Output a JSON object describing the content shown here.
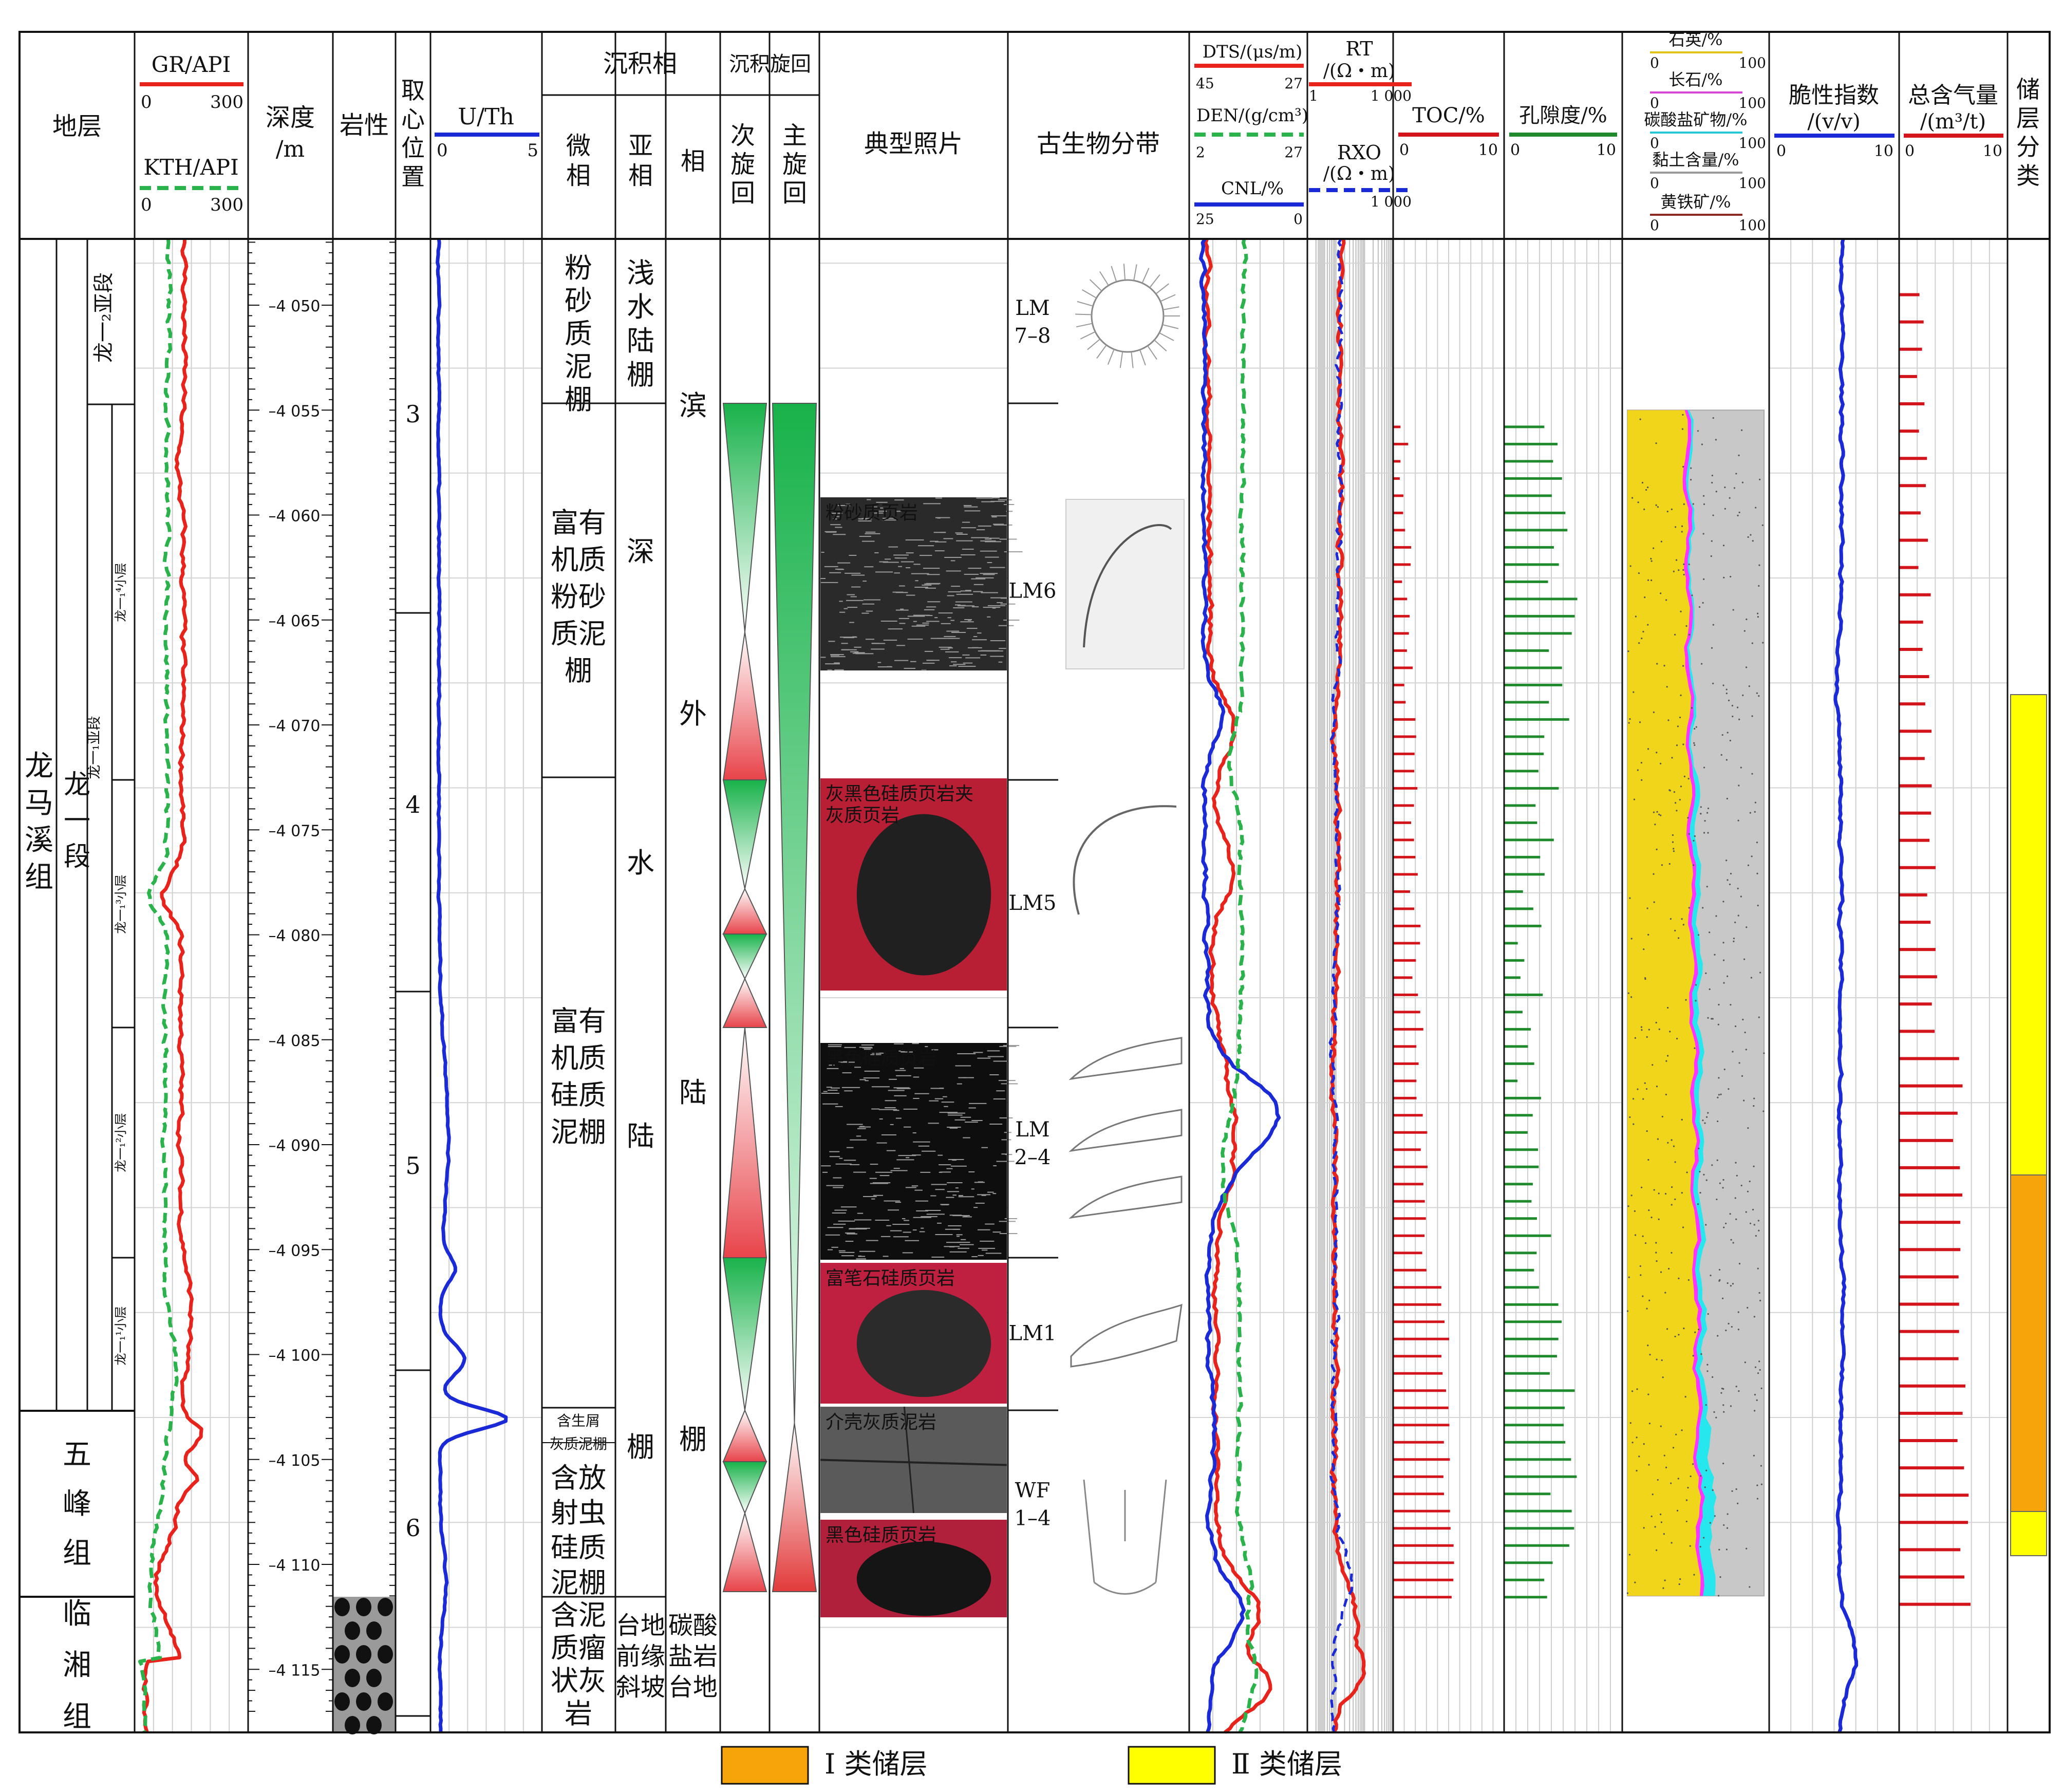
{
  "columns": {
    "strata": "地层",
    "gr": "GR/API",
    "gr_min": "0",
    "gr_max": "300",
    "kth": "KTH/API",
    "kth_min": "0",
    "kth_max": "300",
    "depth": "深度",
    "depth_unit": "/m",
    "lithology": "岩性",
    "core_pos": [
      "取",
      "心",
      "位",
      "置"
    ],
    "uth": "U/Th",
    "uth_min": "0",
    "uth_max": "5",
    "facies": "沉积相",
    "microfacies": [
      "微",
      "相"
    ],
    "subfacies": [
      "亚",
      "相"
    ],
    "facies_sub": "相",
    "cycle": "沉积旋回",
    "sub_cycle": [
      "次",
      "旋",
      "回"
    ],
    "main_cycle": [
      "主",
      "旋",
      "回"
    ],
    "photo": "典型照片",
    "fossil": "古生物分带",
    "dts": "DTS/(μs/m)",
    "dts_min": "45",
    "dts_max": "27",
    "den": "DEN/(g/cm³)",
    "den_min": "2",
    "den_max": "27",
    "cnl": "CNL/%",
    "cnl_min": "25",
    "cnl_max": "0",
    "rt": "RT",
    "rt_unit": "/(Ω・m)",
    "rt_min": "1",
    "rt_max": "1 000",
    "rxo": "RXO",
    "rxo_unit": "/(Ω・m)",
    "rxo_max": "1 000",
    "toc": "TOC/%",
    "toc_min": "0",
    "toc_max": "10",
    "por": "孔隙度/%",
    "por_min": "0",
    "por_max": "10",
    "min_quartz": "石英/%",
    "min_feldspar": "长石/%",
    "min_carb": "碳酸盐矿物/%",
    "min_clay": "黏土含量/%",
    "min_pyrite": "黄铁矿/%",
    "min_lo": "0",
    "min_hi": "100",
    "brittle": "脆性指数",
    "brittle_unit": "/(v/v)",
    "brittle_min": "0",
    "brittle_max": "10",
    "gas": "总含气量",
    "gas_unit": "/(m³/t)",
    "gas_min": "0",
    "gas_max": "10",
    "reservoir": [
      "储",
      "层",
      "分",
      "类"
    ]
  },
  "formations": [
    {
      "name": [
        "龙",
        "马",
        "溪",
        "组"
      ]
    },
    {
      "name": [
        "五",
        "峰",
        "组"
      ]
    },
    {
      "name": [
        "临",
        "湘",
        "组"
      ]
    }
  ],
  "members": {
    "long1": [
      "龙",
      "一",
      "段"
    ],
    "sub2": "龙一₂亚段",
    "sub1": "龙一₁亚段",
    "layers": [
      "龙一₁⁴小层",
      "龙一₁³小层",
      "龙一₁²小层",
      "龙一₁¹小层"
    ]
  },
  "depth_ticks": [
    "4 050",
    "4 055",
    "4 060",
    "4 065",
    "4 070",
    "4 075",
    "4 080",
    "4 085",
    "4 090",
    "4 095",
    "4 100",
    "4 105",
    "4 110",
    "4 115"
  ],
  "core_numbers": [
    "3",
    "4",
    "5",
    "6"
  ],
  "microfacies": {
    "a": [
      "粉",
      "砂",
      "质",
      "泥",
      "棚"
    ],
    "b": [
      "富有",
      "机质",
      "粉砂",
      "质泥",
      "棚"
    ],
    "c": [
      "富有",
      "机质",
      "硅质",
      "泥棚"
    ],
    "d": [
      "含生屑",
      "灰质泥棚"
    ],
    "e": [
      "含放",
      "射虫",
      "硅质",
      "泥棚"
    ],
    "f": [
      "含泥",
      "质瘤",
      "状灰",
      "岩"
    ]
  },
  "subfacies": {
    "a": [
      "浅",
      "水",
      "陆",
      "棚"
    ],
    "b": [
      "深",
      "水",
      "陆",
      "棚"
    ],
    "b_spaced": [
      "深",
      "水",
      "陆"
    ],
    "c": [
      "台地",
      "前缘",
      "斜坡"
    ]
  },
  "facies": {
    "a": [
      "滨",
      "外",
      "陆",
      "棚"
    ],
    "b": [
      "碳酸",
      "盐岩",
      "台地"
    ]
  },
  "photos": [
    {
      "label": "粉砂质页岩"
    },
    {
      "label": "灰黑色硅质页岩夹灰质页岩",
      "line1": "灰黑色硅质页岩夹",
      "line2": "灰质页岩"
    },
    {
      "label": "黑色硅质页岩"
    },
    {
      "label": "富笔石硅质页岩"
    },
    {
      "label": "介壳灰质泥岩"
    },
    {
      "label": "黑色硅质页岩"
    }
  ],
  "fossil_zones": [
    {
      "line1": "LM",
      "line2": "7–8"
    },
    {
      "line1": "LM6",
      "line2": ""
    },
    {
      "line1": "LM5",
      "line2": ""
    },
    {
      "line1": "LM",
      "line2": "2–4"
    },
    {
      "line1": "LM1",
      "line2": ""
    },
    {
      "line1": "WF",
      "line2": "1–4"
    }
  ],
  "legend": {
    "class1": "Ⅰ 类储层",
    "class2": "Ⅱ 类储层",
    "class1_color": "#f7a30a",
    "class2_color": "#ffff00"
  },
  "colors": {
    "gr": "#e8231c",
    "kth": "#29b34a",
    "uth": "#1a2ad6",
    "toc": "#d4141b",
    "por": "#1f8a2c",
    "quartz_fill": "#f0d51a",
    "magenta": "#ff33ff",
    "cyan": "#27e7ee",
    "clay": "#c8c8c8"
  }
}
